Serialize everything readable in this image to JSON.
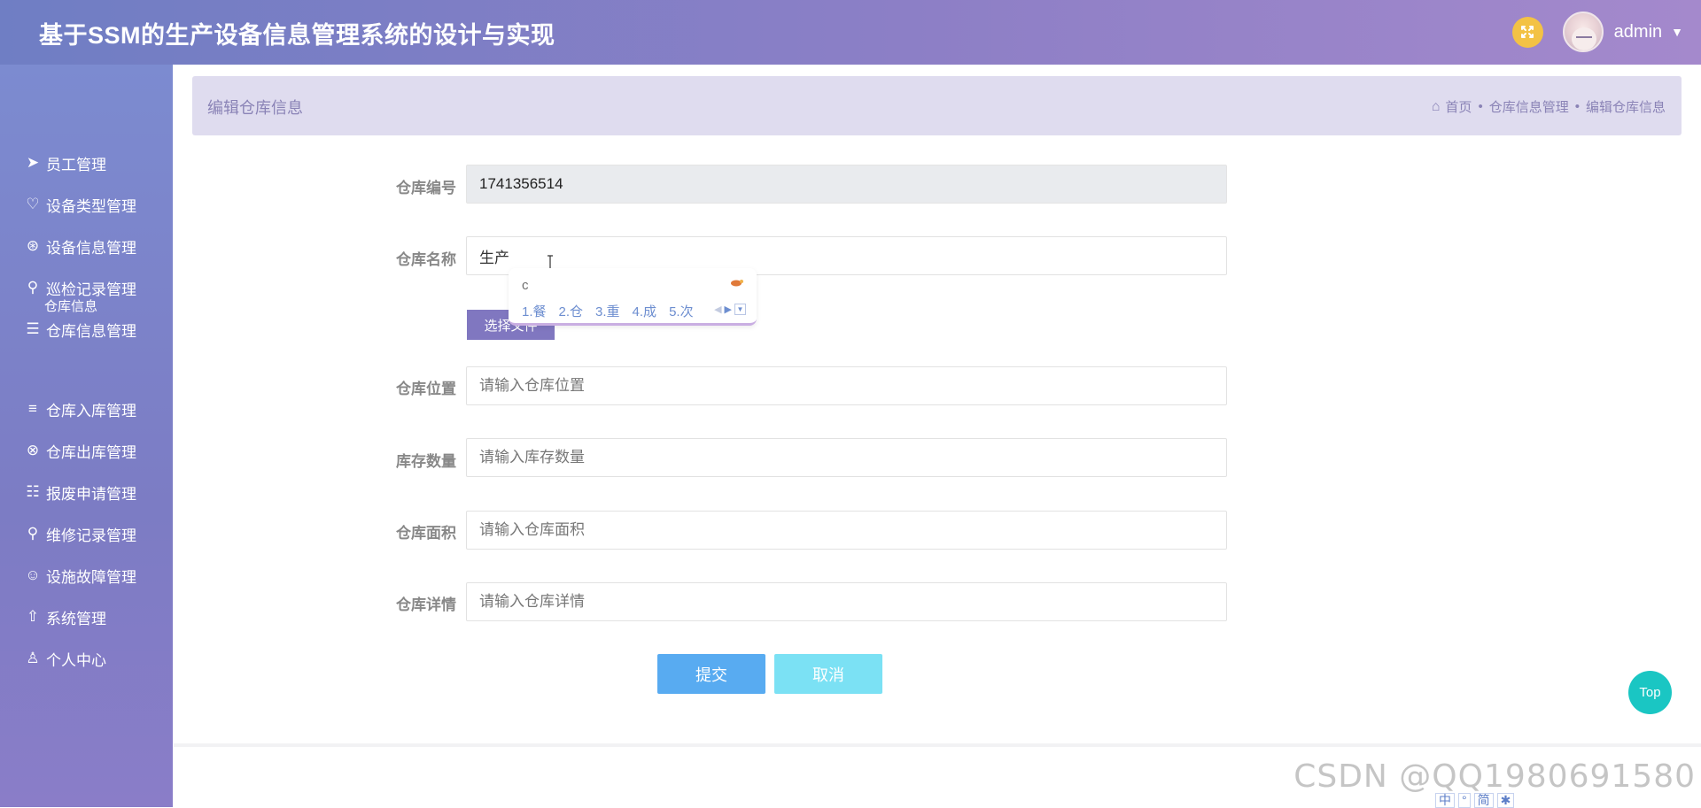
{
  "header": {
    "title": "基于SSM的生产设备信息管理系统的设计与实现",
    "username": "admin"
  },
  "sidebar": {
    "items": [
      {
        "label": "员工管理",
        "icon": "send-icon"
      },
      {
        "label": "设备类型管理",
        "icon": "heart-icon"
      },
      {
        "label": "设备信息管理",
        "icon": "aperture-icon"
      },
      {
        "label": "巡检记录管理",
        "icon": "key-icon"
      },
      {
        "label": "仓库信息管理",
        "icon": "menu-icon"
      },
      {
        "label": "仓库入库管理",
        "icon": "bars-icon"
      },
      {
        "label": "仓库出库管理",
        "icon": "circle-x-icon"
      },
      {
        "label": "报废申请管理",
        "icon": "list-icon"
      },
      {
        "label": "维修记录管理",
        "icon": "search-icon"
      },
      {
        "label": "设施故障管理",
        "icon": "user-circle-icon"
      },
      {
        "label": "系统管理",
        "icon": "arrow-up-circle-icon"
      },
      {
        "label": "个人中心",
        "icon": "user-icon"
      }
    ],
    "sub_item": "仓库信息"
  },
  "breadcrumb": {
    "title": "编辑仓库信息",
    "path": [
      "首页",
      "仓库信息管理",
      "编辑仓库信息"
    ]
  },
  "form": {
    "fields": [
      {
        "label": "仓库编号",
        "value": "1741356514",
        "placeholder": ""
      },
      {
        "label": "仓库名称",
        "value": "生产",
        "placeholder": ""
      },
      {
        "label": "仓库位置",
        "value": "",
        "placeholder": "请输入仓库位置"
      },
      {
        "label": "库存数量",
        "value": "",
        "placeholder": "请输入库存数量"
      },
      {
        "label": "仓库面积",
        "value": "",
        "placeholder": "请输入仓库面积"
      },
      {
        "label": "仓库详情",
        "value": "",
        "placeholder": "请输入仓库详情"
      }
    ],
    "file_button": "选择文件",
    "submit": "提交",
    "cancel": "取消"
  },
  "ime": {
    "input": "c",
    "candidates": [
      "1.餐",
      "2.仓",
      "3.重",
      "4.成",
      "5.次"
    ],
    "status": [
      "中",
      "°",
      "简",
      "✱"
    ]
  },
  "top_button": "Top",
  "watermark": "CSDN @QQ1980691580",
  "colors": {
    "header_start": "#6f7ec4",
    "header_end": "#a489cc",
    "sidebar": "#7c8bd0",
    "breadcrumb_bg": "#dfdcef",
    "submit": "#58abf1",
    "cancel": "#7be1f4",
    "top": "#1ac6c3"
  }
}
